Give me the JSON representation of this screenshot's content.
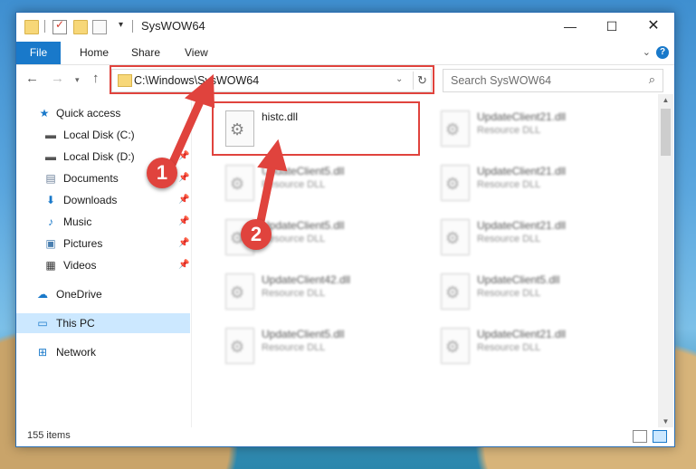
{
  "window": {
    "title": "SysWOW64",
    "controls": {
      "minimize": "—",
      "maximize": "☐",
      "close": "✕"
    }
  },
  "ribbon": {
    "tabs": [
      "File",
      "Home",
      "Share",
      "View"
    ]
  },
  "navigation": {
    "address": "C:\\Windows\\SysWOW64",
    "search_placeholder": "Search SysWOW64"
  },
  "sidebar": {
    "items": [
      {
        "label": "Quick access",
        "icon": "star-icon"
      },
      {
        "label": "Local Disk (C:)",
        "icon": "drive-icon"
      },
      {
        "label": "Local Disk (D:)",
        "icon": "drive-icon"
      },
      {
        "label": "Documents",
        "icon": "documents-icon"
      },
      {
        "label": "Downloads",
        "icon": "downloads-icon"
      },
      {
        "label": "Music",
        "icon": "music-icon"
      },
      {
        "label": "Pictures",
        "icon": "pictures-icon"
      },
      {
        "label": "Videos",
        "icon": "videos-icon"
      },
      {
        "label": "OneDrive",
        "icon": "cloud-icon"
      },
      {
        "label": "This PC",
        "icon": "computer-icon"
      },
      {
        "label": "Network",
        "icon": "network-icon"
      }
    ],
    "selected": "This PC"
  },
  "files": [
    {
      "name": "histc.dll",
      "type": ""
    },
    {
      "name": "UpdateClient21.dll",
      "type": "Resource DLL"
    },
    {
      "name": "UpdateClient5.dll",
      "type": "Resource DLL"
    },
    {
      "name": "UpdateClient21.dll",
      "type": "Resource DLL"
    },
    {
      "name": "UpdateClient5.dll",
      "type": "Resource DLL"
    },
    {
      "name": "UpdateClient21.dll",
      "type": "Resource DLL"
    },
    {
      "name": "UpdateClient42.dll",
      "type": "Resource DLL"
    },
    {
      "name": "UpdateClient5.dll",
      "type": "Resource DLL"
    },
    {
      "name": "UpdateClient5.dll",
      "type": "Resource DLL"
    },
    {
      "name": "UpdateClient21.dll",
      "type": "Resource DLL"
    }
  ],
  "status": {
    "item_count": "155 items"
  },
  "annotations": {
    "step1": "1",
    "step2": "2",
    "color": "#e0433d"
  }
}
